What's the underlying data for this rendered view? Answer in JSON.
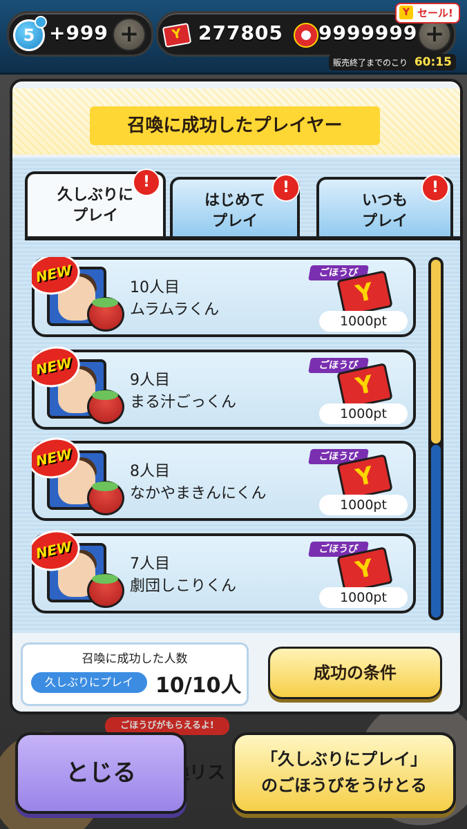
{
  "topbar": {
    "level": "5",
    "left_value": "+999",
    "points": "277805",
    "gifts": "9999999",
    "sale_label": "セール!",
    "sale_icon": "Y",
    "timer_label": "販売終了までのこり",
    "timer_value": "60:15"
  },
  "panel": {
    "title": "召喚に成功したプレイヤー",
    "tabs": [
      {
        "label": "久しぶりに\nプレイ",
        "alert": "!"
      },
      {
        "label": "はじめて\nプレイ",
        "alert": "!"
      },
      {
        "label": "いつも\nプレイ",
        "alert": "!"
      }
    ],
    "items": [
      {
        "badge": "NEW",
        "number": "10人目",
        "name": "ムラムラくん",
        "reward_tag": "ごほうび",
        "reward_icon": "Y",
        "points": "1000pt"
      },
      {
        "badge": "NEW",
        "number": "9人目",
        "name": "まる汁ごっくん",
        "reward_tag": "ごほうび",
        "reward_icon": "Y",
        "points": "1000pt"
      },
      {
        "badge": "NEW",
        "number": "8人目",
        "name": "なかやまきんにくん",
        "reward_tag": "ごほうび",
        "reward_icon": "Y",
        "points": "1000pt"
      },
      {
        "badge": "NEW",
        "number": "7人目",
        "name": "劇団しこりくん",
        "reward_tag": "ごほうび",
        "reward_icon": "Y",
        "points": "1000pt"
      }
    ],
    "count_title": "召喚に成功した人数",
    "count_tag": "久しぶりにプレイ",
    "count_value": "10/10人",
    "condition_button": "成功の条件"
  },
  "footer": {
    "behind_hint": "ごほうびがもらえるよ!",
    "behind_list": "喚リス",
    "close_button": "とじる",
    "receive_line1": "「久しぶりにプレイ」",
    "receive_line2": "のごほうびをうけとる"
  },
  "colors": {
    "accent_yellow": "#f6cf47",
    "close_purple": "#9a84e9",
    "alert_red": "#e3261f",
    "scroll_thumb": "#f2c94c"
  }
}
